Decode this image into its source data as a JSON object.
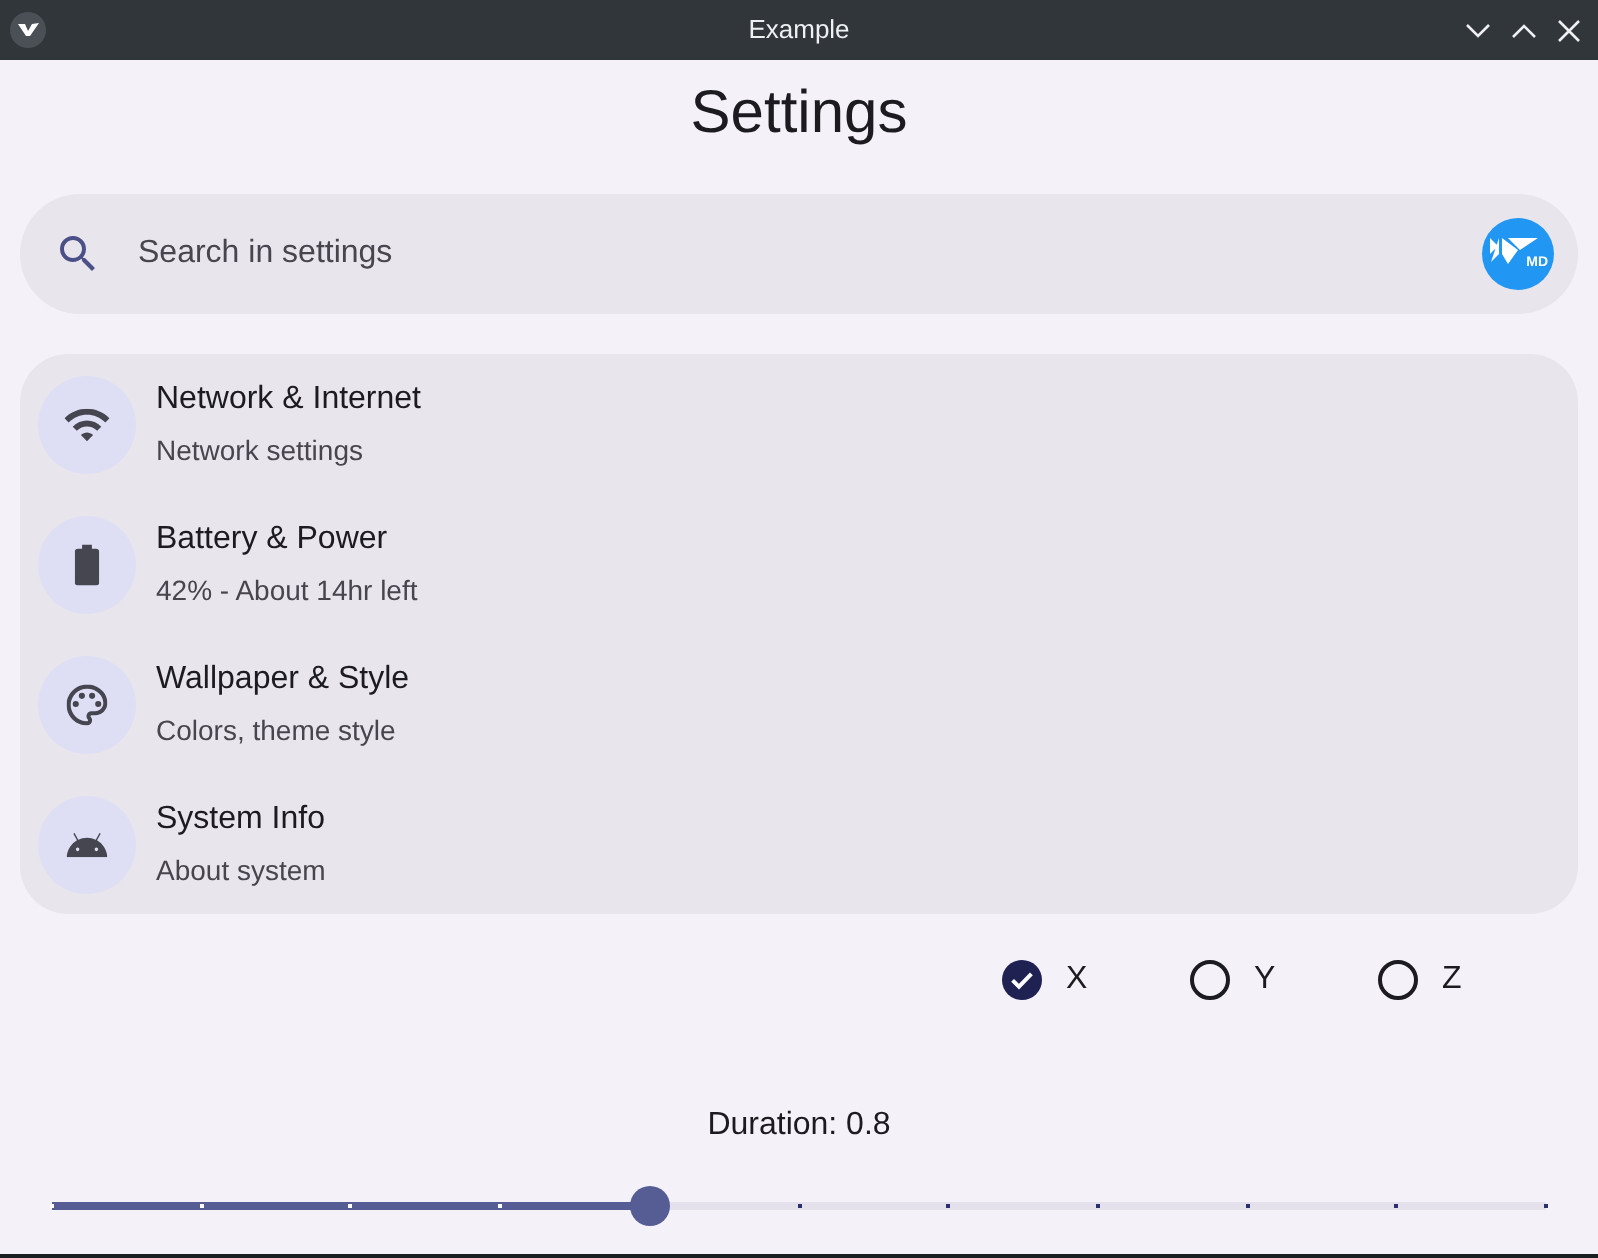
{
  "window": {
    "title": "Example"
  },
  "heading": "Settings",
  "search": {
    "placeholder": "Search in settings",
    "logo_text": "MD"
  },
  "settings_items": [
    {
      "title": "Network & Internet",
      "subtitle": "Network settings"
    },
    {
      "title": "Battery & Power",
      "subtitle": "42% - About 14hr left"
    },
    {
      "title": "Wallpaper & Style",
      "subtitle": "Colors, theme style"
    },
    {
      "title": "System Info",
      "subtitle": "About system"
    }
  ],
  "choices": [
    {
      "label": "X",
      "selected": true
    },
    {
      "label": "Y",
      "selected": false
    },
    {
      "label": "Z",
      "selected": false
    }
  ],
  "slider": {
    "label": "Duration: 0.8",
    "level": 0.4
  }
}
